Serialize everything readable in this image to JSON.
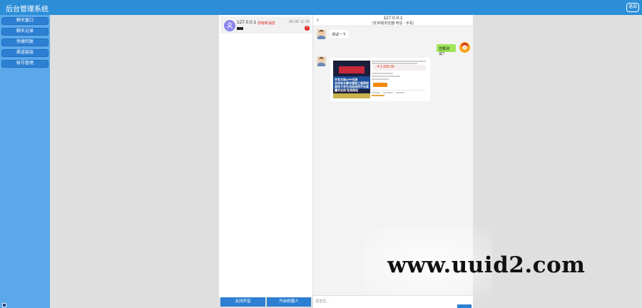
{
  "app": {
    "title": "后台管理系统",
    "logout_label": "退出"
  },
  "sidebar": {
    "items": [
      {
        "label": "聊天窗口"
      },
      {
        "label": "聊天记录"
      },
      {
        "label": "快捷回复"
      },
      {
        "label": "渠道链接"
      },
      {
        "label": "账号管理"
      }
    ]
  },
  "sessions": [
    {
      "ip": "127.0.0.1",
      "tag": "你有新消息",
      "time": "05-06 11:35",
      "unread": "3"
    }
  ],
  "list_buttons": {
    "close_sound": "关闭声音",
    "open_robot": "开启机器人"
  },
  "chat": {
    "back_icon": "chevron-left-icon",
    "header_ip": "127.0.0.1",
    "header_device": "(安卓端浏览器 电信 - 手机)",
    "messages": [
      {
        "side": "left",
        "text": "测试一下"
      },
      {
        "side": "right",
        "text": "您要测试?"
      }
    ],
    "card": {
      "price": "¥ 1,000.00",
      "thumb_lines": [
        "开发文档APP内测",
        "吉林省长春市通信工程高校",
        "高校大学生活动场所平台直播",
        "技术支持 在线网站"
      ]
    },
    "input_placeholder": "发送至..."
  },
  "watermark": "www.uuid2.com",
  "colors": {
    "topbar": "#2d8ed8",
    "sidebar": "#5aa8ea",
    "button": "#2d7fd1",
    "badge": "#e01a1a",
    "bubble_right": "#9ee65a"
  }
}
